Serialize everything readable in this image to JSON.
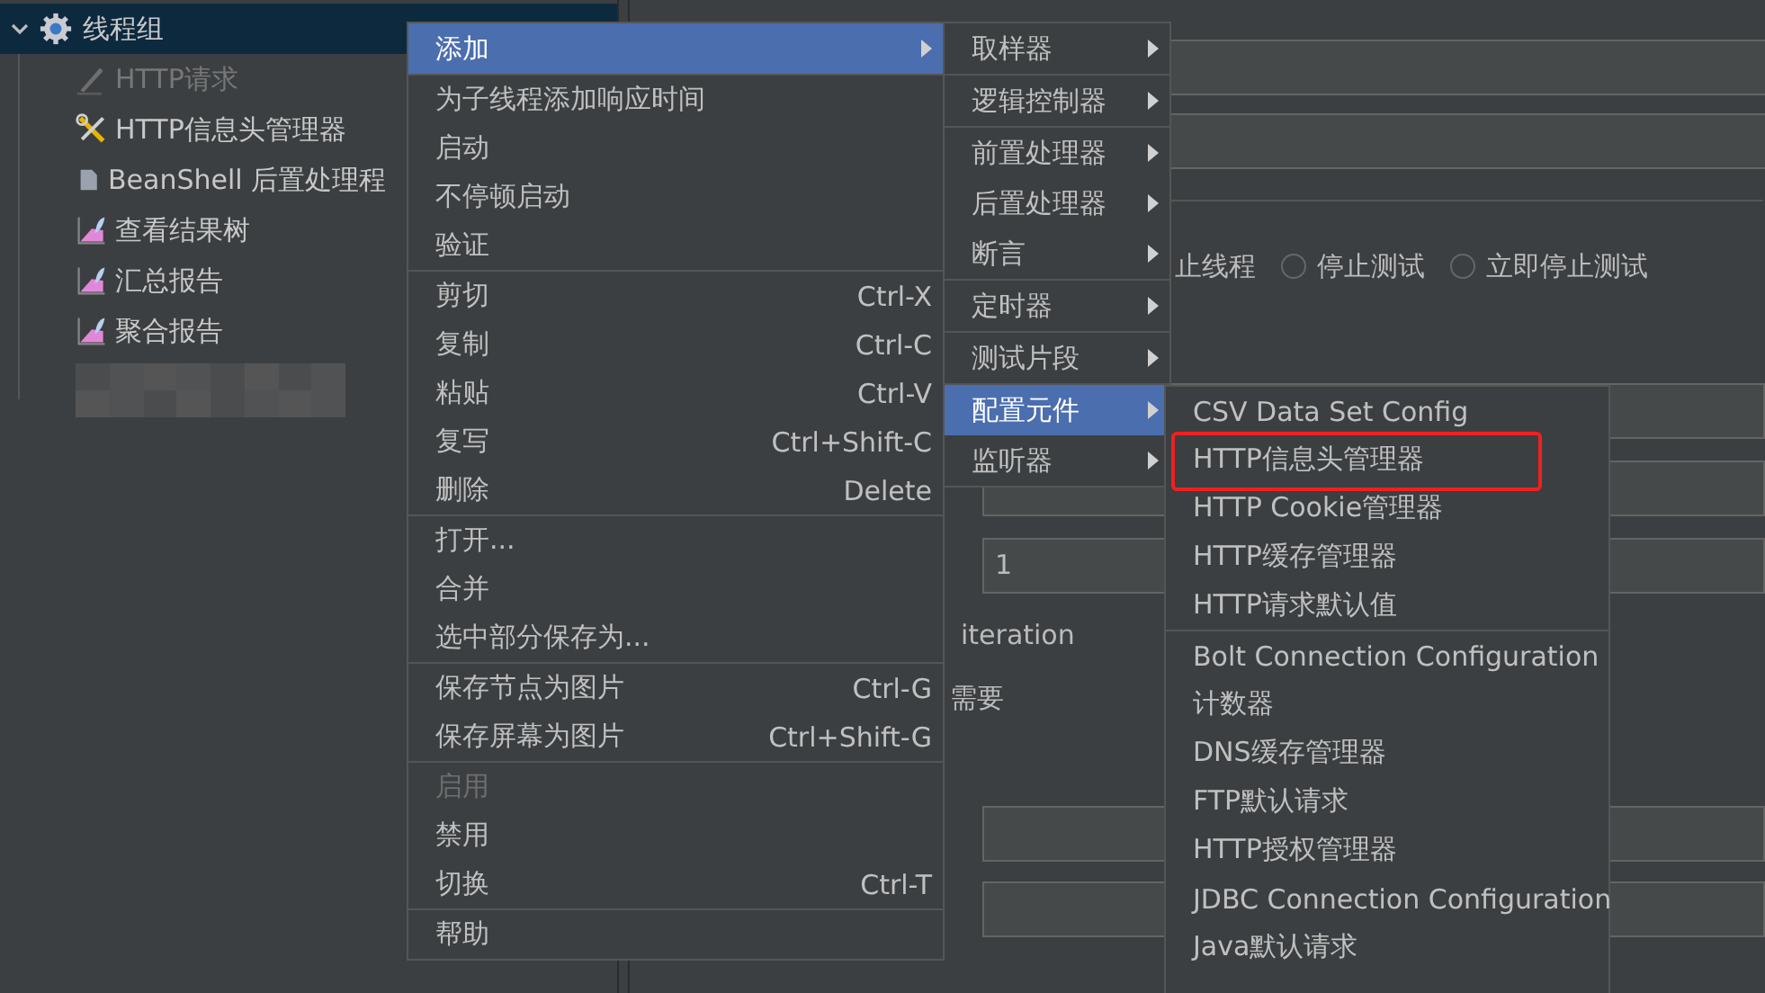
{
  "tree": {
    "root": {
      "label": "线程组",
      "expanded": true,
      "selected": true,
      "children": [
        {
          "label": "HTTP请求",
          "kind": "sampler",
          "disabled": true
        },
        {
          "label": "HTTP信息头管理器",
          "kind": "config",
          "disabled": false
        },
        {
          "label": "BeanShell 后置处理程",
          "kind": "postprocessor",
          "disabled": false
        },
        {
          "label": "查看结果树",
          "kind": "listener",
          "disabled": false
        },
        {
          "label": "汇总报告",
          "kind": "listener",
          "disabled": false
        },
        {
          "label": "聚合报告",
          "kind": "listener",
          "disabled": false
        }
      ]
    }
  },
  "form": {
    "partial_label": "止线程",
    "radios": [
      {
        "label": "停止测试",
        "selected": false
      },
      {
        "label": "立即停止测试",
        "selected": false
      }
    ],
    "values": [
      "1"
    ],
    "iteration_label": "iteration",
    "partial_label_2": "需要"
  },
  "context_menu": {
    "groups": [
      [
        {
          "label": "添加",
          "has_submenu": true,
          "selected": true,
          "disabled": false
        }
      ],
      [
        {
          "label": "为子线程添加响应时间",
          "has_submenu": false,
          "selected": false,
          "disabled": false
        },
        {
          "label": "启动",
          "has_submenu": false,
          "selected": false,
          "disabled": false
        },
        {
          "label": "不停顿启动",
          "has_submenu": false,
          "selected": false,
          "disabled": false
        },
        {
          "label": "验证",
          "has_submenu": false,
          "selected": false,
          "disabled": false
        }
      ],
      [
        {
          "label": "剪切",
          "shortcut": "Ctrl-X",
          "has_submenu": false,
          "selected": false,
          "disabled": false
        },
        {
          "label": "复制",
          "shortcut": "Ctrl-C",
          "has_submenu": false,
          "selected": false,
          "disabled": false
        },
        {
          "label": "粘贴",
          "shortcut": "Ctrl-V",
          "has_submenu": false,
          "selected": false,
          "disabled": false
        },
        {
          "label": "复写",
          "shortcut": "Ctrl+Shift-C",
          "has_submenu": false,
          "selected": false,
          "disabled": false
        },
        {
          "label": "删除",
          "shortcut": "Delete",
          "has_submenu": false,
          "selected": false,
          "disabled": false
        }
      ],
      [
        {
          "label": "打开...",
          "has_submenu": false,
          "selected": false,
          "disabled": false
        },
        {
          "label": "合并",
          "has_submenu": false,
          "selected": false,
          "disabled": false
        },
        {
          "label": "选中部分保存为...",
          "has_submenu": false,
          "selected": false,
          "disabled": false
        }
      ],
      [
        {
          "label": "保存节点为图片",
          "shortcut": "Ctrl-G",
          "has_submenu": false,
          "selected": false,
          "disabled": false
        },
        {
          "label": "保存屏幕为图片",
          "shortcut": "Ctrl+Shift-G",
          "has_submenu": false,
          "selected": false,
          "disabled": false
        }
      ],
      [
        {
          "label": "启用",
          "has_submenu": false,
          "selected": false,
          "disabled": true
        },
        {
          "label": "禁用",
          "has_submenu": false,
          "selected": false,
          "disabled": false
        },
        {
          "label": "切换",
          "shortcut": "Ctrl-T",
          "has_submenu": false,
          "selected": false,
          "disabled": false
        }
      ],
      [
        {
          "label": "帮助",
          "has_submenu": false,
          "selected": false,
          "disabled": false
        }
      ]
    ]
  },
  "add_submenu": {
    "groups": [
      [
        {
          "label": "取样器",
          "has_submenu": true,
          "selected": false
        }
      ],
      [
        {
          "label": "逻辑控制器",
          "has_submenu": true,
          "selected": false
        }
      ],
      [
        {
          "label": "前置处理器",
          "has_submenu": true,
          "selected": false
        },
        {
          "label": "后置处理器",
          "has_submenu": true,
          "selected": false
        },
        {
          "label": "断言",
          "has_submenu": true,
          "selected": false
        }
      ],
      [
        {
          "label": "定时器",
          "has_submenu": true,
          "selected": false
        }
      ],
      [
        {
          "label": "测试片段",
          "has_submenu": true,
          "selected": false
        }
      ],
      [
        {
          "label": "配置元件",
          "has_submenu": true,
          "selected": true
        },
        {
          "label": "监听器",
          "has_submenu": true,
          "selected": false
        }
      ]
    ]
  },
  "config_submenu": {
    "groups": [
      [
        {
          "label": "CSV Data Set Config",
          "selected": false,
          "boxed": false
        },
        {
          "label": "HTTP信息头管理器",
          "selected": false,
          "boxed": true
        },
        {
          "label": "HTTP Cookie管理器",
          "selected": false,
          "boxed": false
        },
        {
          "label": "HTTP缓存管理器",
          "selected": false,
          "boxed": false
        },
        {
          "label": "HTTP请求默认值",
          "selected": false,
          "boxed": false
        }
      ],
      [
        {
          "label": "Bolt Connection Configuration",
          "selected": false,
          "boxed": false
        },
        {
          "label": "计数器",
          "selected": false,
          "boxed": false
        },
        {
          "label": "DNS缓存管理器",
          "selected": false,
          "boxed": false
        },
        {
          "label": "FTP默认请求",
          "selected": false,
          "boxed": false
        },
        {
          "label": "HTTP授权管理器",
          "selected": false,
          "boxed": false
        },
        {
          "label": "JDBC Connection Configuration",
          "selected": false,
          "boxed": false
        },
        {
          "label": "Java默认请求",
          "selected": false,
          "boxed": false
        }
      ]
    ]
  }
}
